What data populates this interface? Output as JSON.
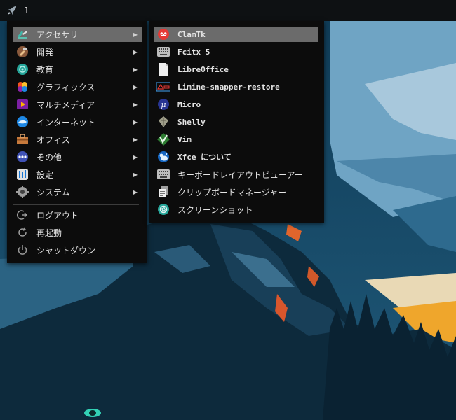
{
  "panel": {
    "workspace": "1"
  },
  "main_menu": {
    "items": [
      {
        "label": "アクセサリ",
        "icon": "accessories-icon"
      },
      {
        "label": "開発",
        "icon": "development-icon"
      },
      {
        "label": "教育",
        "icon": "education-icon"
      },
      {
        "label": "グラフィックス",
        "icon": "graphics-icon"
      },
      {
        "label": "マルチメディア",
        "icon": "multimedia-icon"
      },
      {
        "label": "インターネット",
        "icon": "internet-icon"
      },
      {
        "label": "オフィス",
        "icon": "office-icon"
      },
      {
        "label": "その他",
        "icon": "other-icon"
      },
      {
        "label": "設定",
        "icon": "settings-icon"
      },
      {
        "label": "システム",
        "icon": "system-icon"
      }
    ],
    "session": [
      {
        "label": "ログアウト",
        "icon": "logout-icon"
      },
      {
        "label": "再起動",
        "icon": "restart-icon"
      },
      {
        "label": "シャットダウン",
        "icon": "shutdown-icon"
      }
    ],
    "arrow": "▶"
  },
  "sub_menu": {
    "items": [
      {
        "label": "ClamTk",
        "icon": "clamtk-icon"
      },
      {
        "label": "Fcitx 5",
        "icon": "keyboard-icon"
      },
      {
        "label": "LibreOffice",
        "icon": "document-icon"
      },
      {
        "label": "Limine-snapper-restore",
        "icon": "limine-icon"
      },
      {
        "label": "Micro",
        "icon": "micro-icon"
      },
      {
        "label": "Shelly",
        "icon": "shelly-icon"
      },
      {
        "label": "Vim",
        "icon": "vim-icon"
      },
      {
        "label": "Xfce について",
        "icon": "xfce-icon"
      },
      {
        "label": "キーボードレイアウトビューアー",
        "icon": "keyboard-layout-icon"
      },
      {
        "label": "クリップボードマネージャー",
        "icon": "clipboard-icon"
      },
      {
        "label": "スクリーンショット",
        "icon": "screenshot-icon"
      }
    ]
  },
  "colors": {
    "menu_bg": "#0c0c0c",
    "highlight": "#6b6b6b",
    "panel_bg": "#0e1113"
  }
}
